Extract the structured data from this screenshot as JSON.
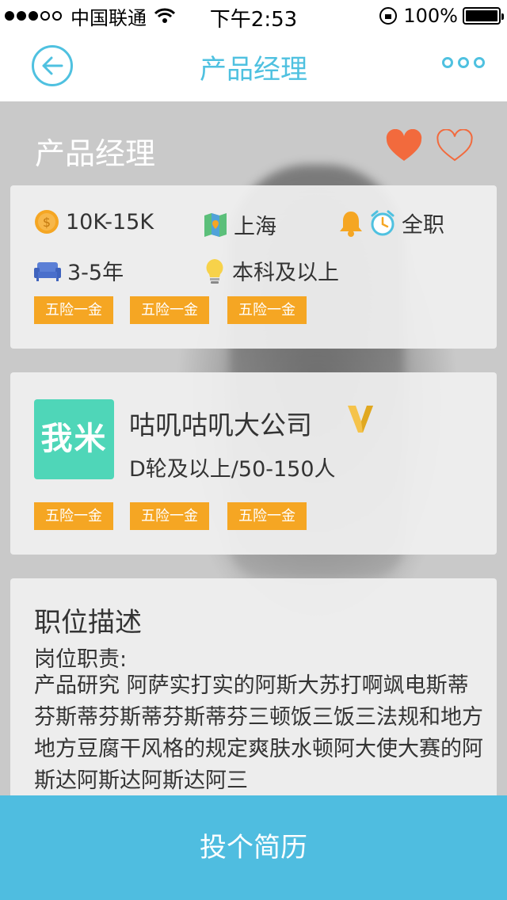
{
  "status_bar": {
    "carrier": "中国联通",
    "time": "下午2:53",
    "battery": "100%"
  },
  "nav": {
    "title": "产品经理"
  },
  "job": {
    "title": "产品经理",
    "salary": "10K-15K",
    "city": "上海",
    "type": "全职",
    "experience": "3-5年",
    "education": "本科及以上",
    "tags": [
      "五险一金",
      "五险一金",
      "五险一金"
    ]
  },
  "company": {
    "logo_text": "我米",
    "name": "咕叽咕叽大公司",
    "info": "D轮及以上/50-150人",
    "tags": [
      "五险一金",
      "五险一金",
      "五险一金"
    ]
  },
  "description": {
    "title": "职位描述",
    "subtitle": "岗位职责:",
    "body": "产品研究 阿萨实打实的阿斯大苏打啊飒电斯蒂芬斯蒂芬斯蒂芬斯蒂芬三顿饭三饭三法规和地方地方豆腐干风格的规定爽肤水顿阿大使大赛的阿斯达阿斯达阿斯达阿三"
  },
  "apply_button": "投个简历",
  "colors": {
    "accent": "#4fc1e0",
    "tag": "#f5a623",
    "heart": "#f26a3d",
    "logo": "#4fd6b8"
  }
}
